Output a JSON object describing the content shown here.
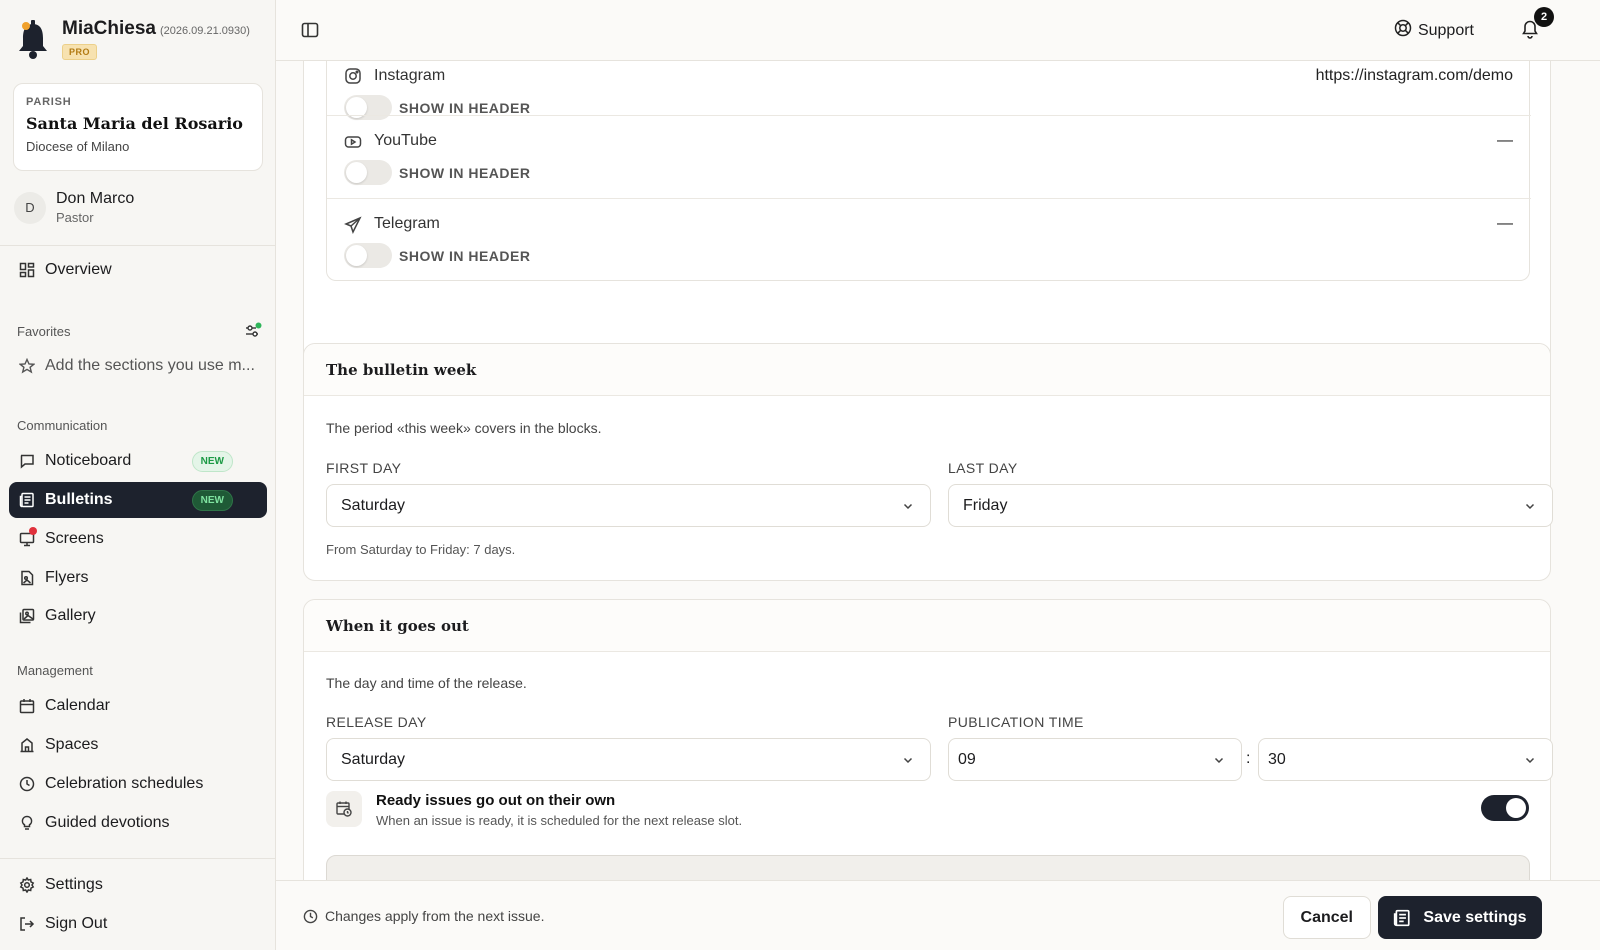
{
  "app": {
    "name": "MiaChiesa",
    "version": "(2026.09.21.0930)",
    "plan_badge": "PRO"
  },
  "parish": {
    "label": "PARISH",
    "name": "Santa Maria del Rosario",
    "diocese": "Diocese of Milano"
  },
  "user": {
    "initial": "D",
    "name": "Don Marco",
    "role": "Pastor"
  },
  "sidebar": {
    "overview": "Overview",
    "favorites_label": "Favorites",
    "favorites_hint": "Add the sections you use m...",
    "communication_label": "Communication",
    "communication_items": [
      {
        "label": "Noticeboard",
        "badge": "NEW"
      },
      {
        "label": "Bulletins",
        "badge": "NEW",
        "active": true
      },
      {
        "label": "Screens"
      },
      {
        "label": "Flyers"
      },
      {
        "label": "Gallery"
      }
    ],
    "management_label": "Management",
    "management_items": [
      {
        "label": "Calendar"
      },
      {
        "label": "Spaces"
      },
      {
        "label": "Celebration schedules"
      },
      {
        "label": "Guided devotions"
      }
    ],
    "settings": "Settings",
    "sign_out": "Sign Out"
  },
  "topbar": {
    "support": "Support",
    "notifications_count": "2"
  },
  "social": {
    "rows": [
      {
        "icon": "instagram-icon",
        "name": "Instagram",
        "value": "https://instagram.com/demo",
        "toggle_label": "SHOW IN HEADER",
        "show_in_header": false
      },
      {
        "icon": "youtube-icon",
        "name": "YouTube",
        "value": "—",
        "toggle_label": "SHOW IN HEADER",
        "show_in_header": false
      },
      {
        "icon": "telegram-icon",
        "name": "Telegram",
        "value": "—",
        "toggle_label": "SHOW IN HEADER",
        "show_in_header": false
      }
    ]
  },
  "bulletin_week": {
    "title": "The bulletin week",
    "description": "The period «this week» covers in the blocks.",
    "first_day_label": "FIRST DAY",
    "first_day": "Saturday",
    "last_day_label": "LAST DAY",
    "last_day": "Friday",
    "summary": "From Saturday to Friday: 7 days."
  },
  "release": {
    "title": "When it goes out",
    "description": "The day and time of the release.",
    "release_day_label": "RELEASE DAY",
    "release_day": "Saturday",
    "publication_time_label": "PUBLICATION TIME",
    "hour": "09",
    "separator": ":",
    "minute": "30",
    "auto_title": "Ready issues go out on their own",
    "auto_subtitle": "When an issue is ready, it is scheduled for the next release slot.",
    "auto_enabled": true
  },
  "footer": {
    "note": "Changes apply from the next issue.",
    "cancel": "Cancel",
    "save": "Save settings"
  }
}
